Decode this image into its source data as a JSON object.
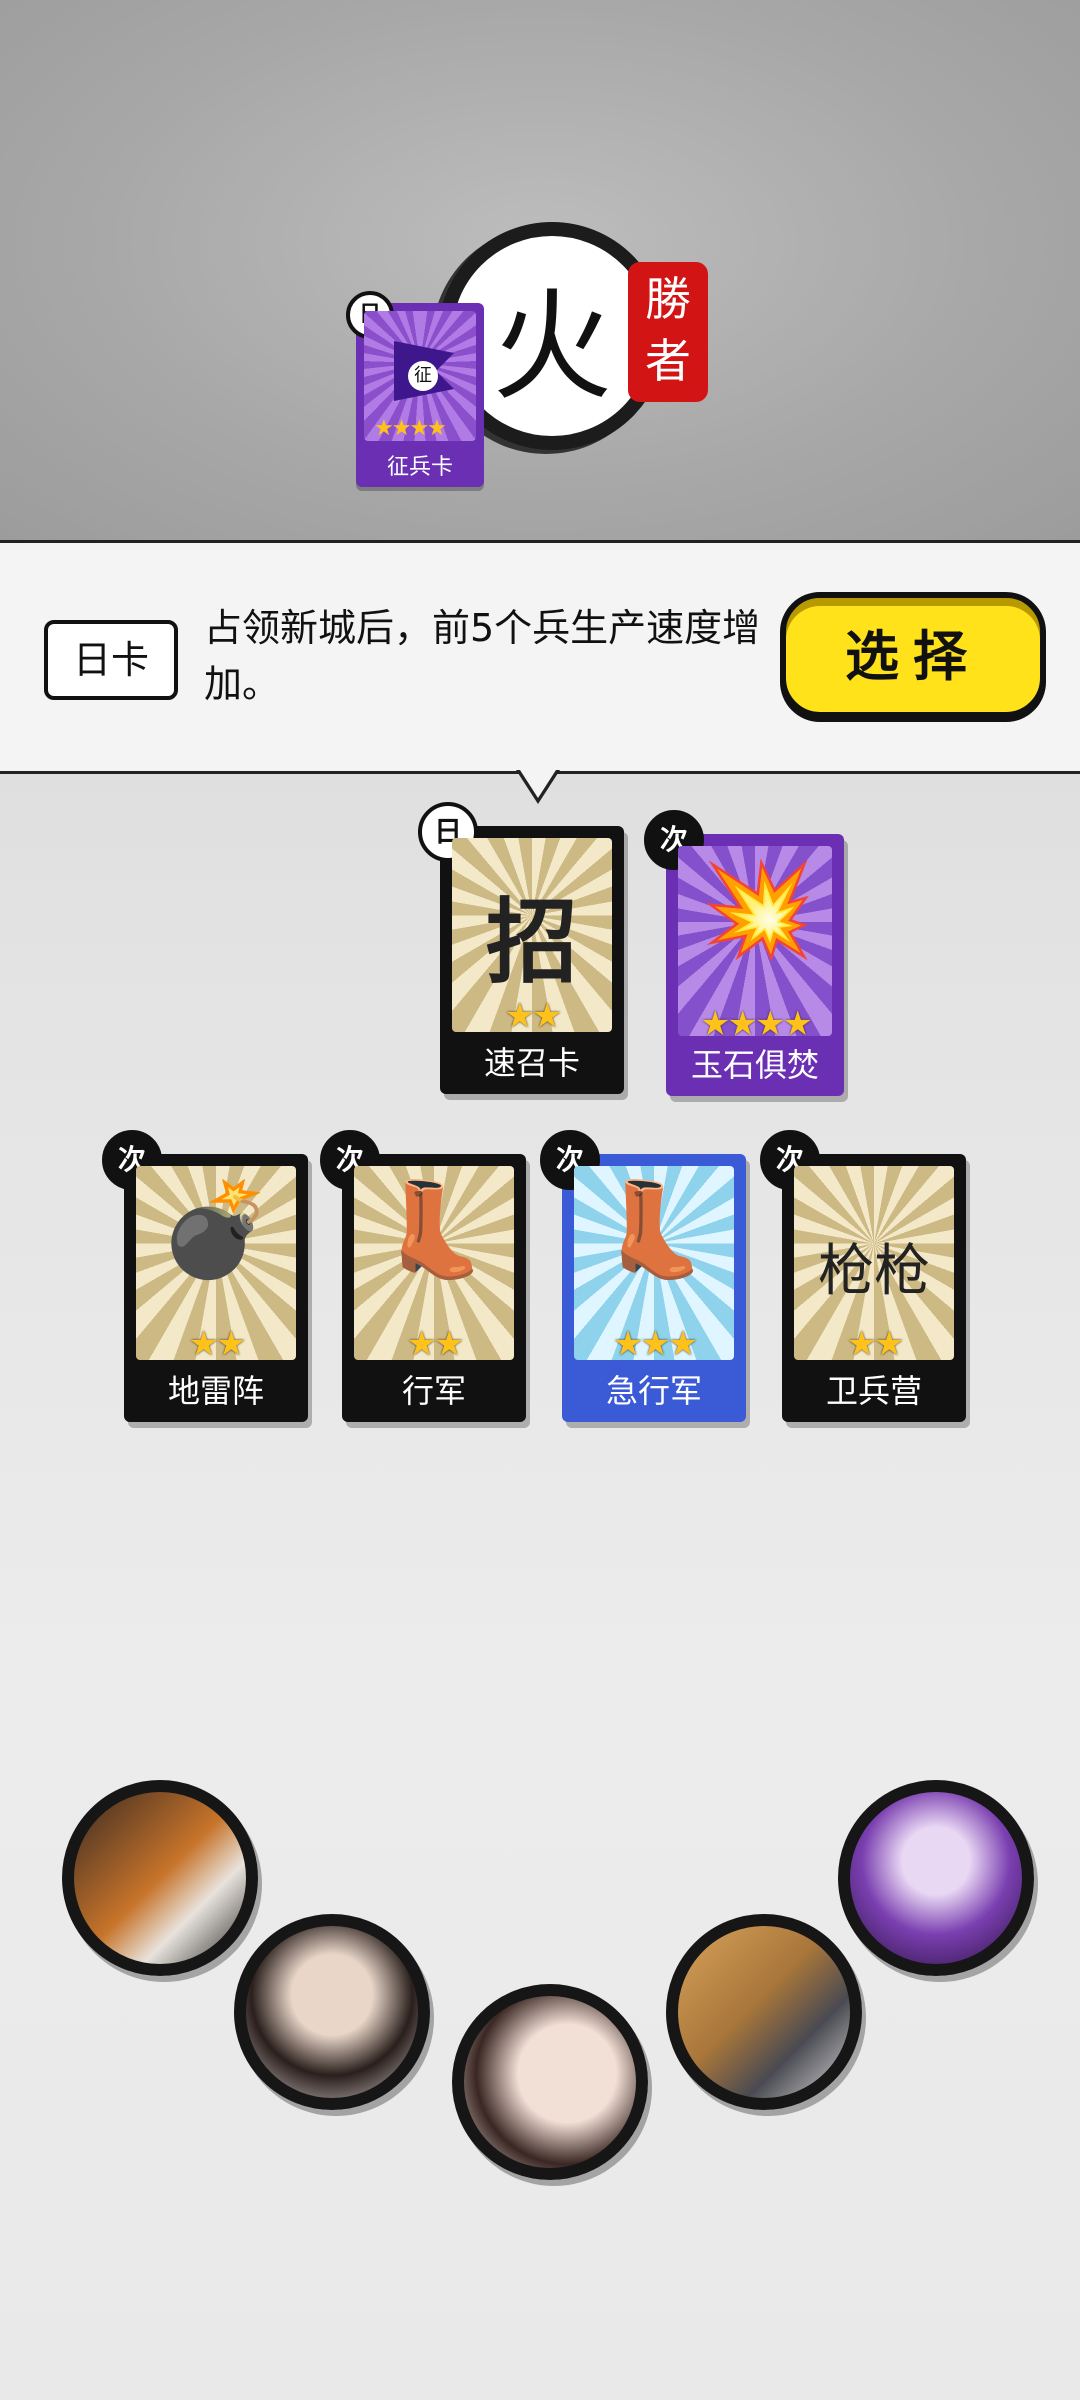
{
  "winner": {
    "glyph": "⽕",
    "seal_text": "勝者",
    "mini_card": {
      "badge": "日",
      "label": "征兵卡",
      "flag_char": "征",
      "stars": "★★★★"
    }
  },
  "info": {
    "tag": "日卡",
    "description": "占领新城后，前5个兵生产速度增加。",
    "select_label": "选择"
  },
  "cards": [
    {
      "badge": "日",
      "name": "速召卡",
      "stars": "★★",
      "glyph": "招"
    },
    {
      "badge": "次",
      "name": "玉石俱焚",
      "stars": "★★★★",
      "glyph": "💥"
    },
    {
      "badge": "次",
      "name": "地雷阵",
      "stars": "★★",
      "glyph": "💣"
    },
    {
      "badge": "次",
      "name": "行军",
      "stars": "★★",
      "glyph": "👢"
    },
    {
      "badge": "次",
      "name": "急行军",
      "stars": "★★★",
      "glyph": "👢"
    },
    {
      "badge": "次",
      "name": "卫兵营",
      "stars": "★★",
      "glyph": "枪枪"
    }
  ],
  "colors": {
    "select_button": "#ffe21a",
    "seal_red": "#d21414",
    "card_purple": "#6a2fb3",
    "card_blue": "#3a5ad6",
    "star_gold": "#ffc21a"
  }
}
